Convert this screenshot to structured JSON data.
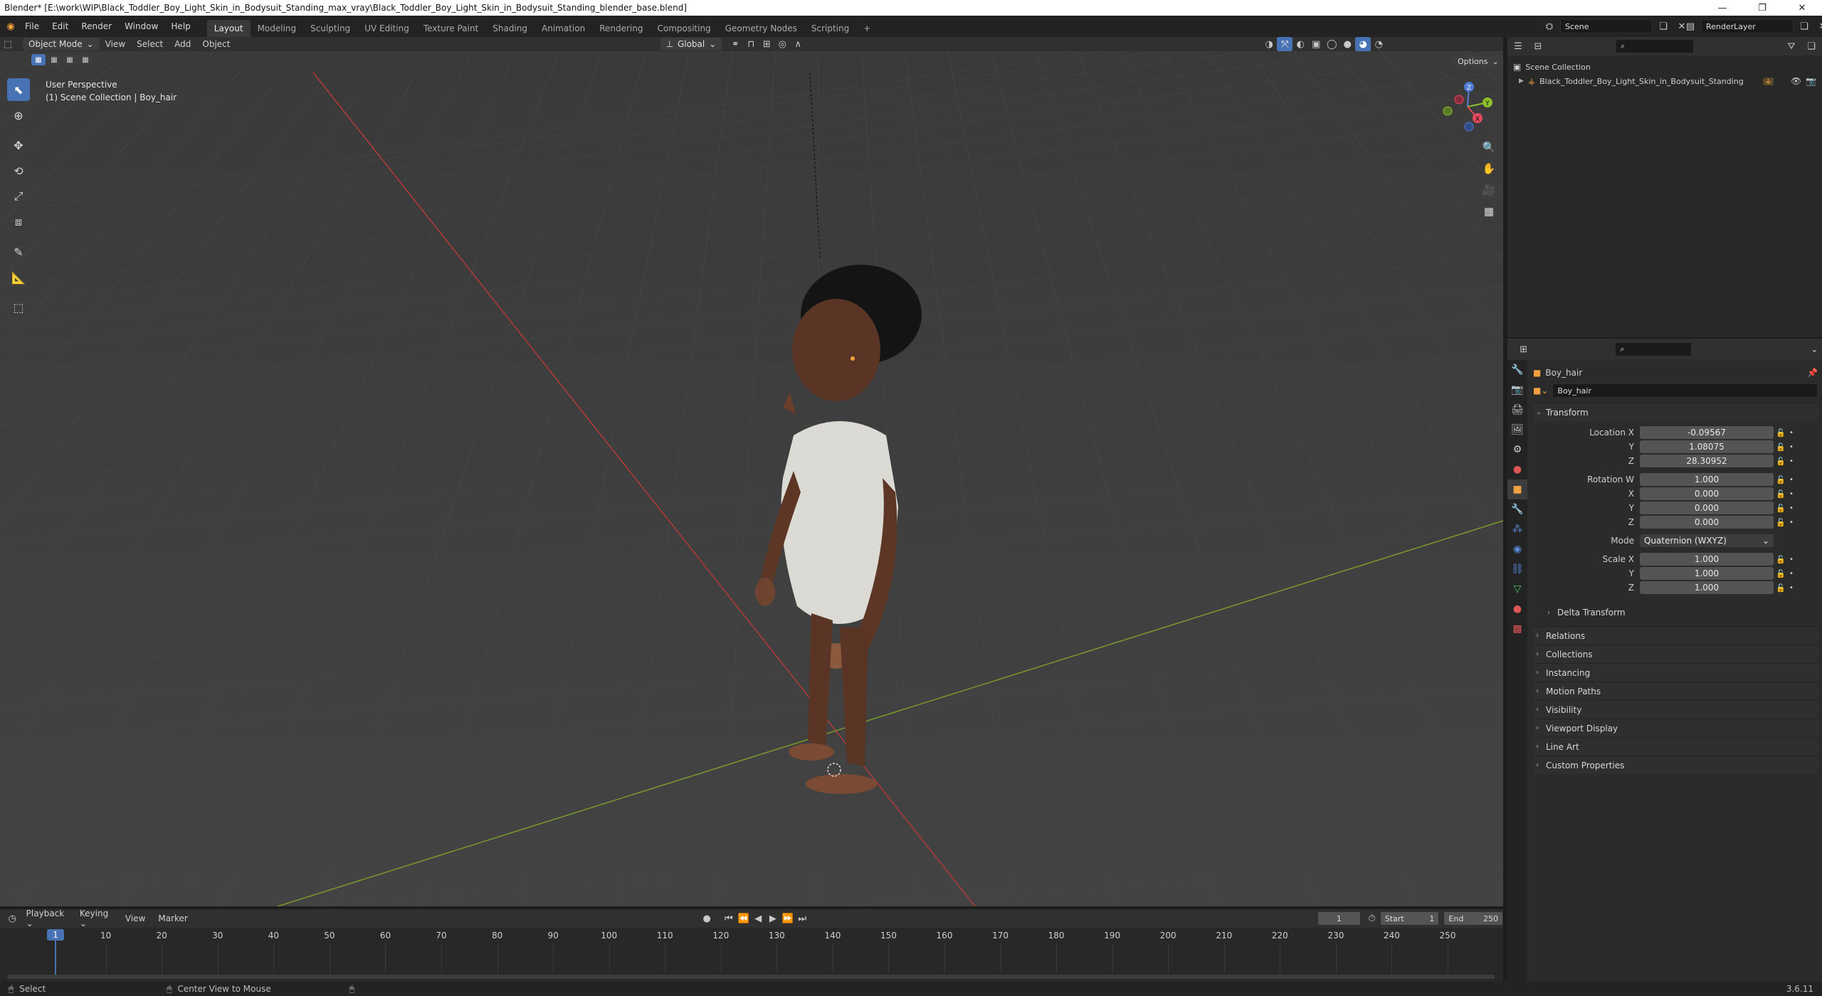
{
  "window": {
    "title": "Blender* [E:\\work\\WIP\\Black_Toddler_Boy_Light_Skin_in_Bodysuit_Standing_max_vray\\Black_Toddler_Boy_Light_Skin_in_Bodysuit_Standing_blender_base.blend]",
    "minimize": "—",
    "maximize": "❐",
    "close": "✕"
  },
  "menu": [
    "File",
    "Edit",
    "Render",
    "Window",
    "Help"
  ],
  "workspaces": [
    "Layout",
    "Modeling",
    "Sculpting",
    "UV Editing",
    "Texture Paint",
    "Shading",
    "Animation",
    "Rendering",
    "Compositing",
    "Geometry Nodes",
    "Scripting"
  ],
  "workspace_add": "+",
  "scene": {
    "name": "Scene",
    "render_layer": "RenderLayer"
  },
  "viewport": {
    "mode": "Object Mode",
    "menus": [
      "View",
      "Select",
      "Add",
      "Object"
    ],
    "orientation": "Global",
    "options": "Options",
    "overlay_title": "User Perspective",
    "overlay_sub": "(1) Scene Collection | Boy_hair",
    "gizmo": {
      "x": "X",
      "y": "Y",
      "z": "Z"
    }
  },
  "outliner": {
    "root": "Scene Collection",
    "item": "Black_Toddler_Boy_Light_Skin_in_Bodysuit_Standing"
  },
  "properties": {
    "object_name": "Boy_hair",
    "data_name": "Boy_hair",
    "transform_title": "Transform",
    "location": {
      "label": "Location X",
      "x": "-0.09567",
      "y": "1.08075",
      "z": "28.30952"
    },
    "rotation": {
      "label": "Rotation W",
      "w": "1.000",
      "x": "0.000",
      "y": "0.000",
      "z": "0.000"
    },
    "mode": {
      "label": "Mode",
      "value": "Quaternion (WXYZ)"
    },
    "scale": {
      "label": "Scale X",
      "x": "1.000",
      "y": "1.000",
      "z": "1.000"
    },
    "axis_labels": {
      "y": "Y",
      "z": "Z",
      "x": "X"
    },
    "delta": "Delta Transform",
    "panels": [
      "Relations",
      "Collections",
      "Instancing",
      "Motion Paths",
      "Visibility",
      "Viewport Display",
      "Line Art",
      "Custom Properties"
    ]
  },
  "timeline": {
    "menus": [
      "Playback",
      "Keying",
      "View",
      "Marker"
    ],
    "current_frame": "1",
    "start_label": "Start",
    "start": "1",
    "end_label": "End",
    "end": "250",
    "ticks": [
      "10",
      "20",
      "30",
      "40",
      "50",
      "60",
      "70",
      "80",
      "90",
      "100",
      "110",
      "120",
      "130",
      "140",
      "150",
      "160",
      "170",
      "180",
      "190",
      "200",
      "210",
      "220",
      "230",
      "240",
      "250"
    ]
  },
  "status": {
    "select": "Select",
    "center": "Center View to Mouse",
    "version": "3.6.11"
  }
}
